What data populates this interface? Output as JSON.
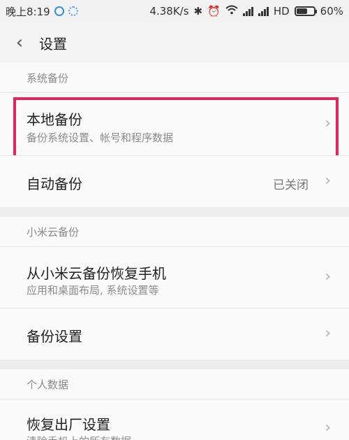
{
  "status_bar": {
    "time": "晚上8:19",
    "speed": "4.38K/s",
    "hd": "HD",
    "battery": "60%"
  },
  "header": {
    "back_symbol": "‹",
    "title": "设置"
  },
  "sections": [
    {
      "label": "系统备份",
      "items": [
        {
          "title": "本地备份",
          "subtitle": "备份系统设置、帐号和程序数据"
        },
        {
          "title": "自动备份",
          "value": "已关闭"
        }
      ]
    },
    {
      "label": "小米云备份",
      "items": [
        {
          "title": "从小米云备份恢复手机",
          "subtitle": "应用和桌面布局, 系统设置等"
        },
        {
          "title": "备份设置"
        }
      ]
    },
    {
      "label": "个人数据",
      "items": [
        {
          "title": "恢复出厂设置",
          "subtitle": "清除手机上的所有数据"
        }
      ]
    }
  ],
  "chevron": "›",
  "colors": {
    "highlight": "#e2265a",
    "background": "#efefef",
    "row": "#fafafa"
  }
}
